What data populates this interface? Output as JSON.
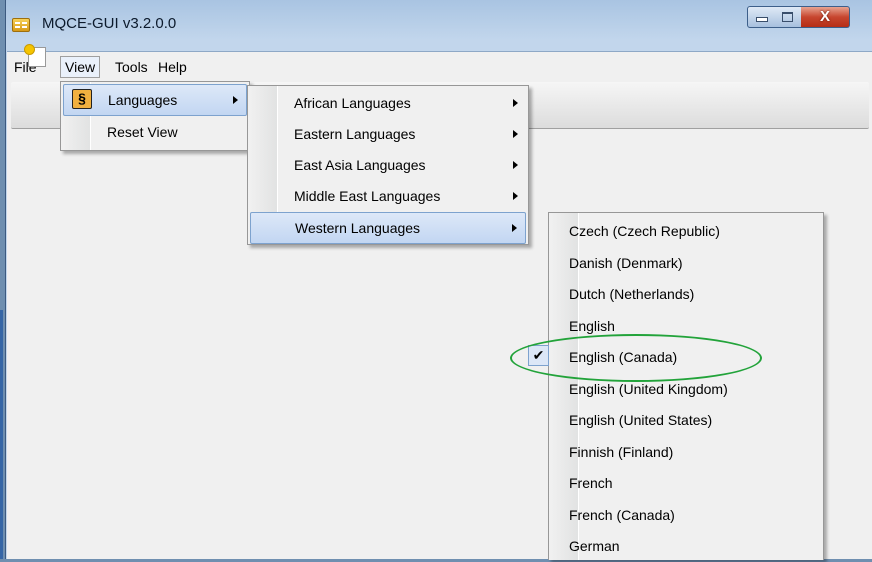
{
  "window": {
    "title": "MQCE-GUI v3.2.0.0",
    "close_glyph": "X"
  },
  "menubar": {
    "file": "File",
    "view": "View",
    "tools": "Tools",
    "help": "Help"
  },
  "view_menu": {
    "languages": "Languages",
    "reset_view": "Reset View",
    "icon_glyph": "§"
  },
  "languages_menu": {
    "items": [
      "African Languages",
      "Eastern Languages",
      "East Asia Languages",
      "Middle East Languages",
      "Western Languages"
    ],
    "highlighted": "Western Languages"
  },
  "western_menu": {
    "items": [
      "Czech (Czech Republic)",
      "Danish (Denmark)",
      "Dutch (Netherlands)",
      "English",
      "English (Canada)",
      "English (United Kingdom)",
      "English (United States)",
      "Finnish (Finland)",
      "French",
      "French (Canada)",
      "German"
    ],
    "checked": "English (Canada)",
    "check_glyph": "✔"
  },
  "colors": {
    "highlight": "#c2d6f2",
    "annotation": "#22a33a"
  }
}
